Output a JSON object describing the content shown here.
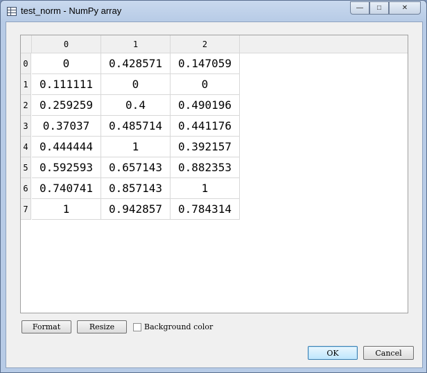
{
  "window": {
    "title": "test_norm - NumPy array",
    "controls": {
      "minimize": "—",
      "maximize": "□",
      "close": "✕"
    }
  },
  "grid": {
    "column_headers": [
      "0",
      "1",
      "2"
    ],
    "row_headers": [
      "0",
      "1",
      "2",
      "3",
      "4",
      "5",
      "6",
      "7"
    ],
    "rows": [
      [
        "0",
        "0.428571",
        "0.147059"
      ],
      [
        "0.111111",
        "0",
        "0"
      ],
      [
        "0.259259",
        "0.4",
        "0.490196"
      ],
      [
        "0.37037",
        "0.485714",
        "0.441176"
      ],
      [
        "0.444444",
        "1",
        "0.392157"
      ],
      [
        "0.592593",
        "0.657143",
        "0.882353"
      ],
      [
        "0.740741",
        "0.857143",
        "1"
      ],
      [
        "1",
        "0.942857",
        "0.784314"
      ]
    ]
  },
  "toolbar": {
    "format_label": "Format",
    "resize_label": "Resize",
    "background_color_label": "Background color",
    "background_color_checked": false
  },
  "dialog_buttons": {
    "ok_label": "OK",
    "cancel_label": "Cancel"
  }
}
